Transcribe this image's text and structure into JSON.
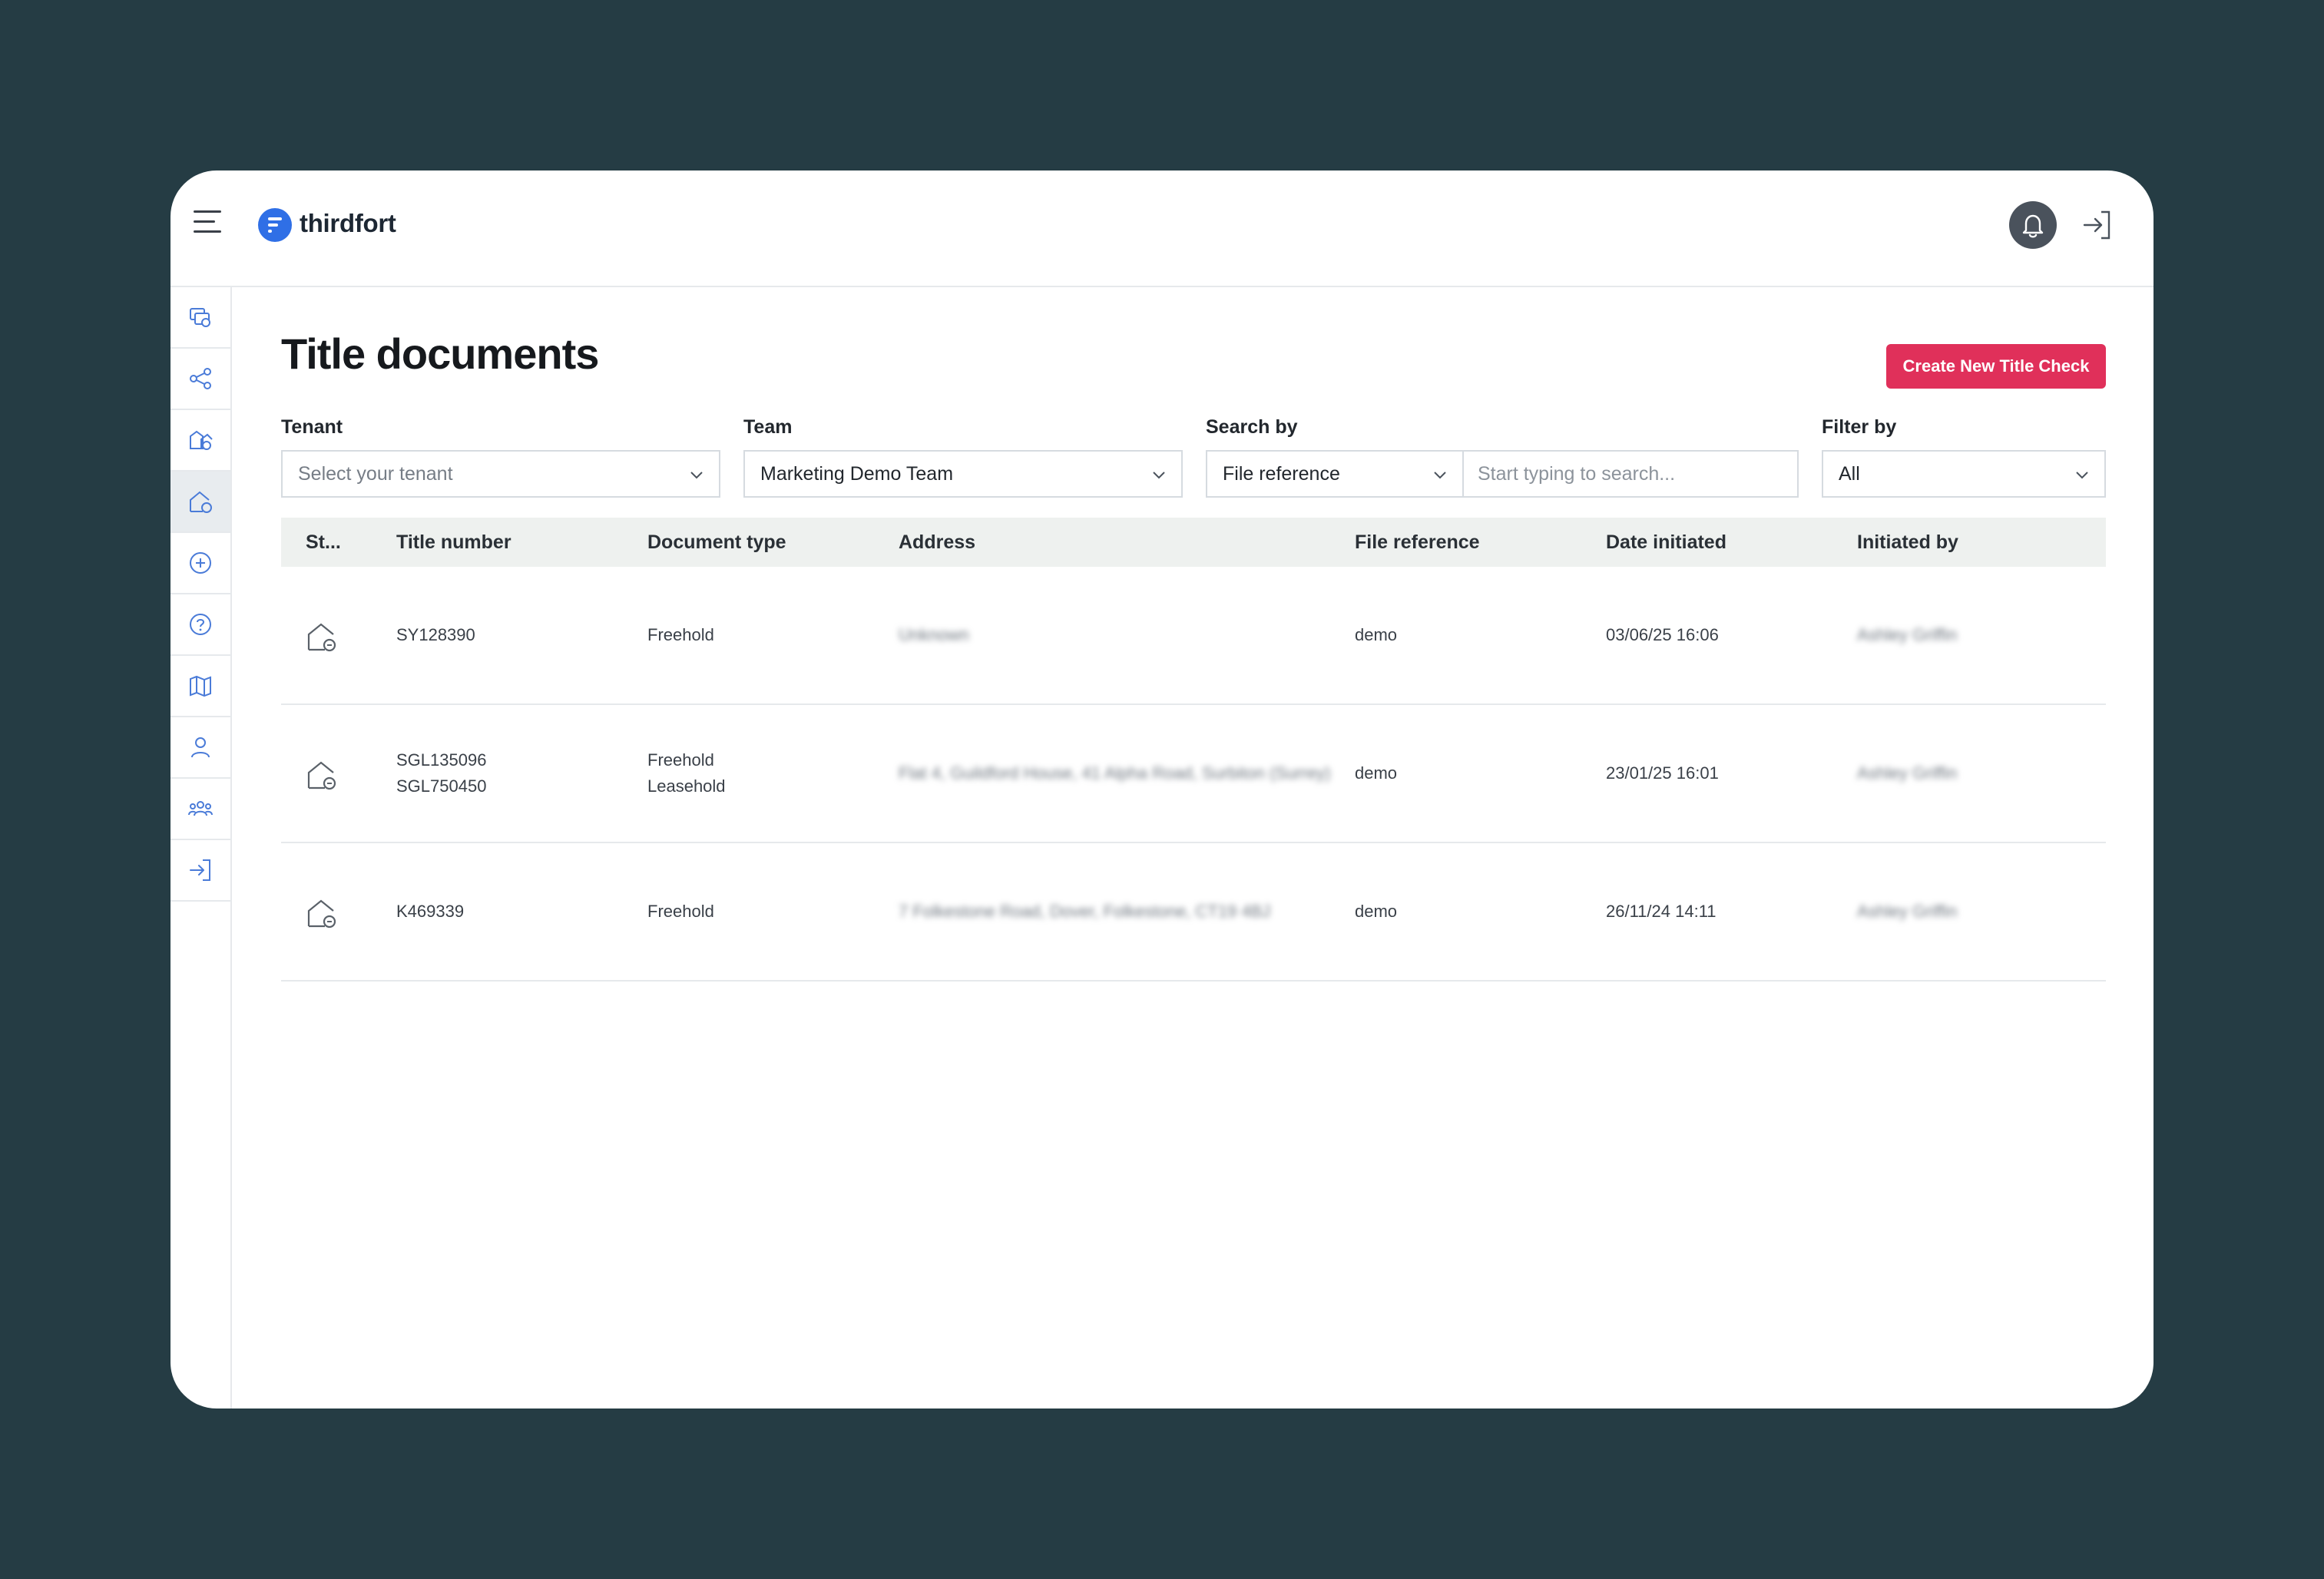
{
  "brand": {
    "name": "thirdfort",
    "accent": "#2f6fe6"
  },
  "topbar": {
    "menu_icon": "hamburger-icon",
    "bell_icon": "bell-icon",
    "logout_icon": "sign-out-icon"
  },
  "sidebar": {
    "items": [
      {
        "icon": "id-check-icon"
      },
      {
        "icon": "share-icon"
      },
      {
        "icon": "property-check-icon"
      },
      {
        "icon": "title-document-icon",
        "active": true
      },
      {
        "icon": "plus-circle-icon"
      },
      {
        "icon": "help-icon"
      },
      {
        "icon": "map-icon"
      },
      {
        "icon": "user-icon"
      },
      {
        "icon": "team-icon"
      },
      {
        "icon": "sign-out-icon"
      }
    ]
  },
  "page": {
    "title": "Title documents",
    "create_button": "Create New Title Check",
    "create_button_color": "#e0305a"
  },
  "filters": {
    "tenant": {
      "label": "Tenant",
      "placeholder": "Select your tenant"
    },
    "team": {
      "label": "Team",
      "value": "Marketing Demo Team"
    },
    "search_by": {
      "label": "Search by",
      "value": "File reference",
      "placeholder": "Start typing to search..."
    },
    "filter_by": {
      "label": "Filter by",
      "value": "All"
    }
  },
  "table": {
    "columns": [
      "St...",
      "Title number",
      "Document type",
      "Address",
      "File reference",
      "Date initiated",
      "Initiated by"
    ],
    "rows": [
      {
        "status_icon": "title-document-icon",
        "title_numbers": [
          "SY128390"
        ],
        "document_types": [
          "Freehold"
        ],
        "address": "Unknown",
        "file_reference": "demo",
        "date_initiated": "03/06/25 16:06",
        "initiated_by": "Ashley Griffin"
      },
      {
        "status_icon": "title-document-icon",
        "title_numbers": [
          "SGL135096",
          "SGL750450"
        ],
        "document_types": [
          "Freehold",
          "Leasehold"
        ],
        "address": "Flat 4, Guildford House, 41 Alpha Road, Surbiton (Surrey)",
        "file_reference": "demo",
        "date_initiated": "23/01/25 16:01",
        "initiated_by": "Ashley Griffin"
      },
      {
        "status_icon": "title-document-icon",
        "title_numbers": [
          "K469339"
        ],
        "document_types": [
          "Freehold"
        ],
        "address": "7 Folkestone Road, Dover, Folkestone, CT19 4BJ",
        "file_reference": "demo",
        "date_initiated": "26/11/24 14:11",
        "initiated_by": "Ashley Griffin"
      }
    ]
  }
}
